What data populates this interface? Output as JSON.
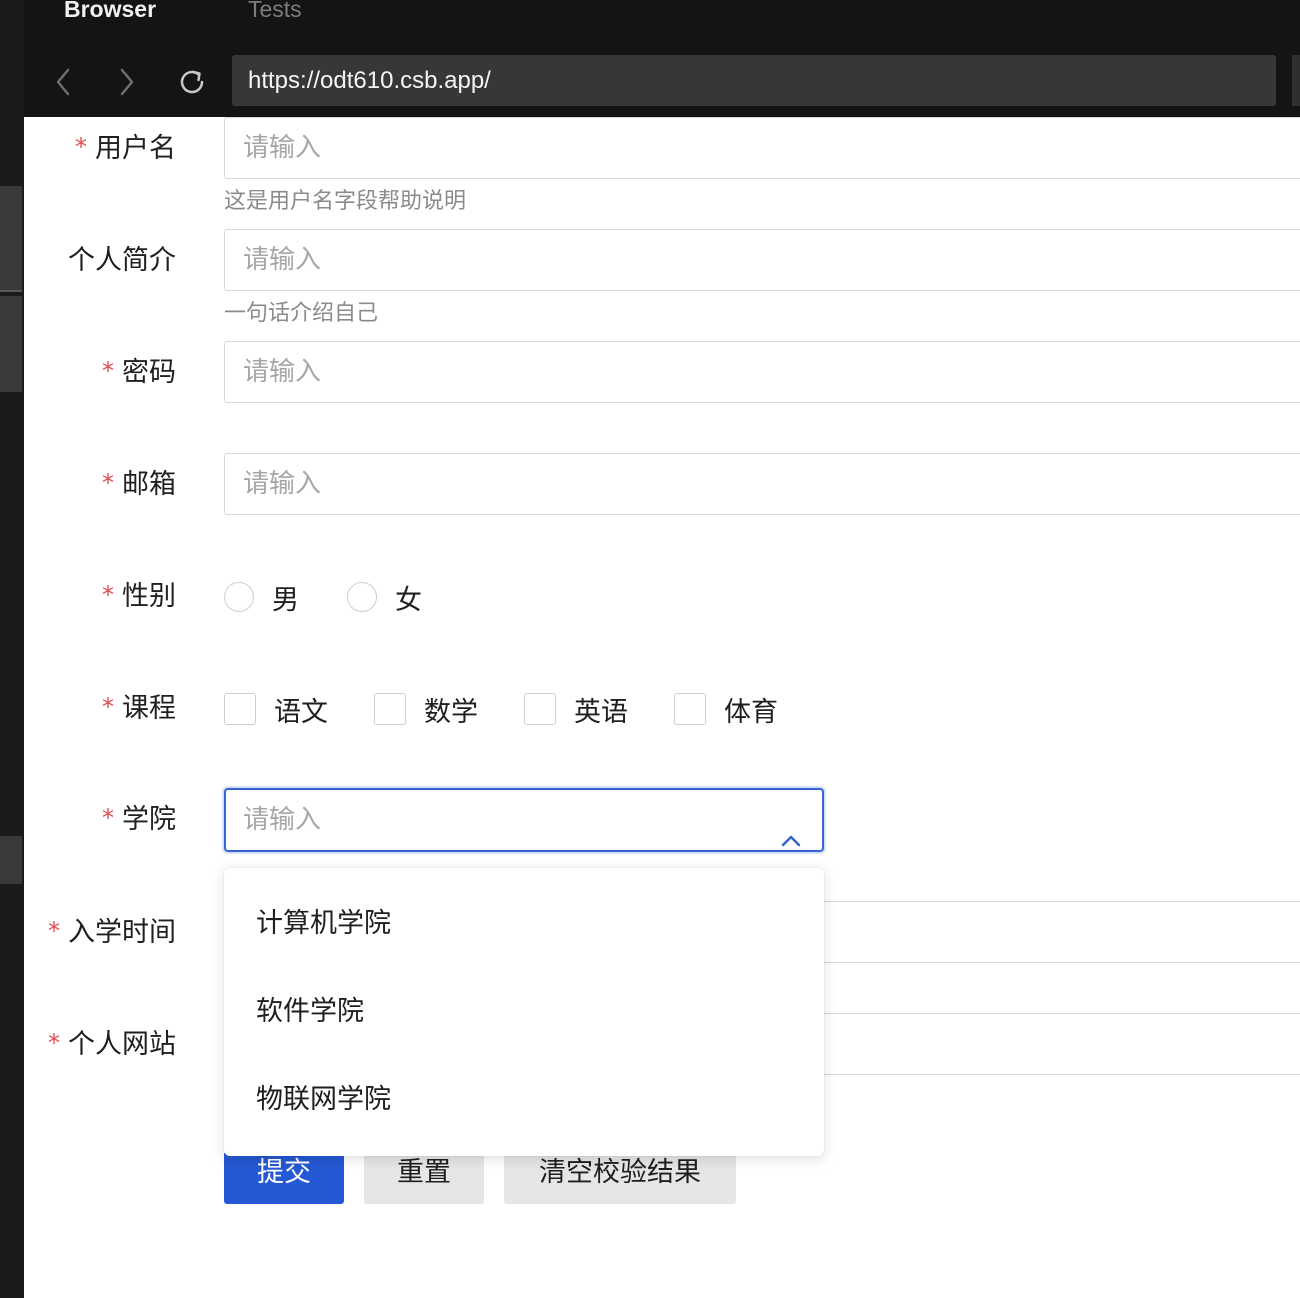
{
  "browser": {
    "tabs": [
      {
        "label": "Browser",
        "active": true
      },
      {
        "label": "Tests",
        "active": false
      }
    ],
    "url": "https://odt610.csb.app/"
  },
  "form": {
    "placeholder": "请输入",
    "username": {
      "label": "用户名",
      "required": true,
      "help": "这是用户名字段帮助说明"
    },
    "bio": {
      "label": "个人简介",
      "required": false,
      "help": "一句话介绍自己"
    },
    "password": {
      "label": "密码",
      "required": true
    },
    "email": {
      "label": "邮箱",
      "required": true
    },
    "gender": {
      "label": "性别",
      "required": true,
      "options": [
        "男",
        "女"
      ]
    },
    "courses": {
      "label": "课程",
      "required": true,
      "options": [
        "语文",
        "数学",
        "英语",
        "体育"
      ]
    },
    "college": {
      "label": "学院",
      "required": true,
      "expanded": true,
      "options": [
        "计算机学院",
        "软件学院",
        "物联网学院"
      ]
    },
    "enroll_date": {
      "label": "入学时间",
      "required": true
    },
    "website": {
      "label": "个人网站",
      "required": true
    },
    "required_mark": "*",
    "buttons": {
      "submit": "提交",
      "reset": "重置",
      "clear": "清空校验结果"
    }
  },
  "colors": {
    "primary": "#2558d4",
    "required": "#e34d4d",
    "focus_border": "#3565cf"
  }
}
